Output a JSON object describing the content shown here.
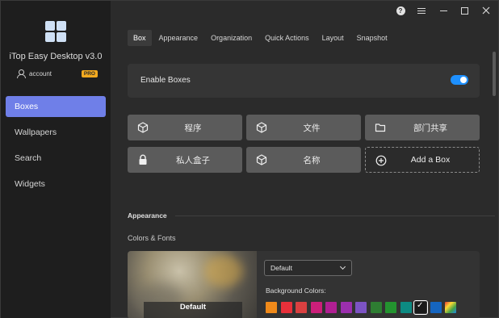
{
  "app": {
    "title": "iTop Easy Desktop v3.0",
    "account_label": "account",
    "pro_badge": "PRO"
  },
  "sidebar": {
    "items": [
      {
        "label": "Boxes",
        "active": true
      },
      {
        "label": "Wallpapers",
        "active": false
      },
      {
        "label": "Search",
        "active": false
      },
      {
        "label": "Widgets",
        "active": false
      }
    ]
  },
  "tabs": [
    {
      "label": "Box",
      "active": true
    },
    {
      "label": "Appearance",
      "active": false
    },
    {
      "label": "Organization",
      "active": false
    },
    {
      "label": "Quick Actions",
      "active": false
    },
    {
      "label": "Layout",
      "active": false
    },
    {
      "label": "Snapshot",
      "active": false
    }
  ],
  "enable_boxes": {
    "label": "Enable Boxes",
    "enabled": true
  },
  "boxes": [
    {
      "label": "程序",
      "icon": "cube-icon"
    },
    {
      "label": "文件",
      "icon": "cube-icon"
    },
    {
      "label": "部门共享",
      "icon": "folder-icon"
    },
    {
      "label": "私人盒子",
      "icon": "lock-icon"
    },
    {
      "label": "名称",
      "icon": "cube-icon"
    },
    {
      "label": "Add a Box",
      "icon": "plus-circle-icon"
    }
  ],
  "appearance": {
    "section_title": "Appearance",
    "colors_fonts_label": "Colors & Fonts",
    "preview_label": "Default",
    "theme_select_value": "Default",
    "background_colors_label": "Background Colors:",
    "swatches": [
      "#f08a1a",
      "#e8303a",
      "#d94040",
      "#cc1f7a",
      "#b01f92",
      "#9b2fae",
      "#7c53c3",
      "#2e7d32",
      "#23932f",
      "#0d8a82",
      "#1a1a1a",
      "#1565c0",
      "#gradient"
    ],
    "selected_swatch_index": 10
  },
  "titlebar": {
    "help_glyph": "?"
  }
}
